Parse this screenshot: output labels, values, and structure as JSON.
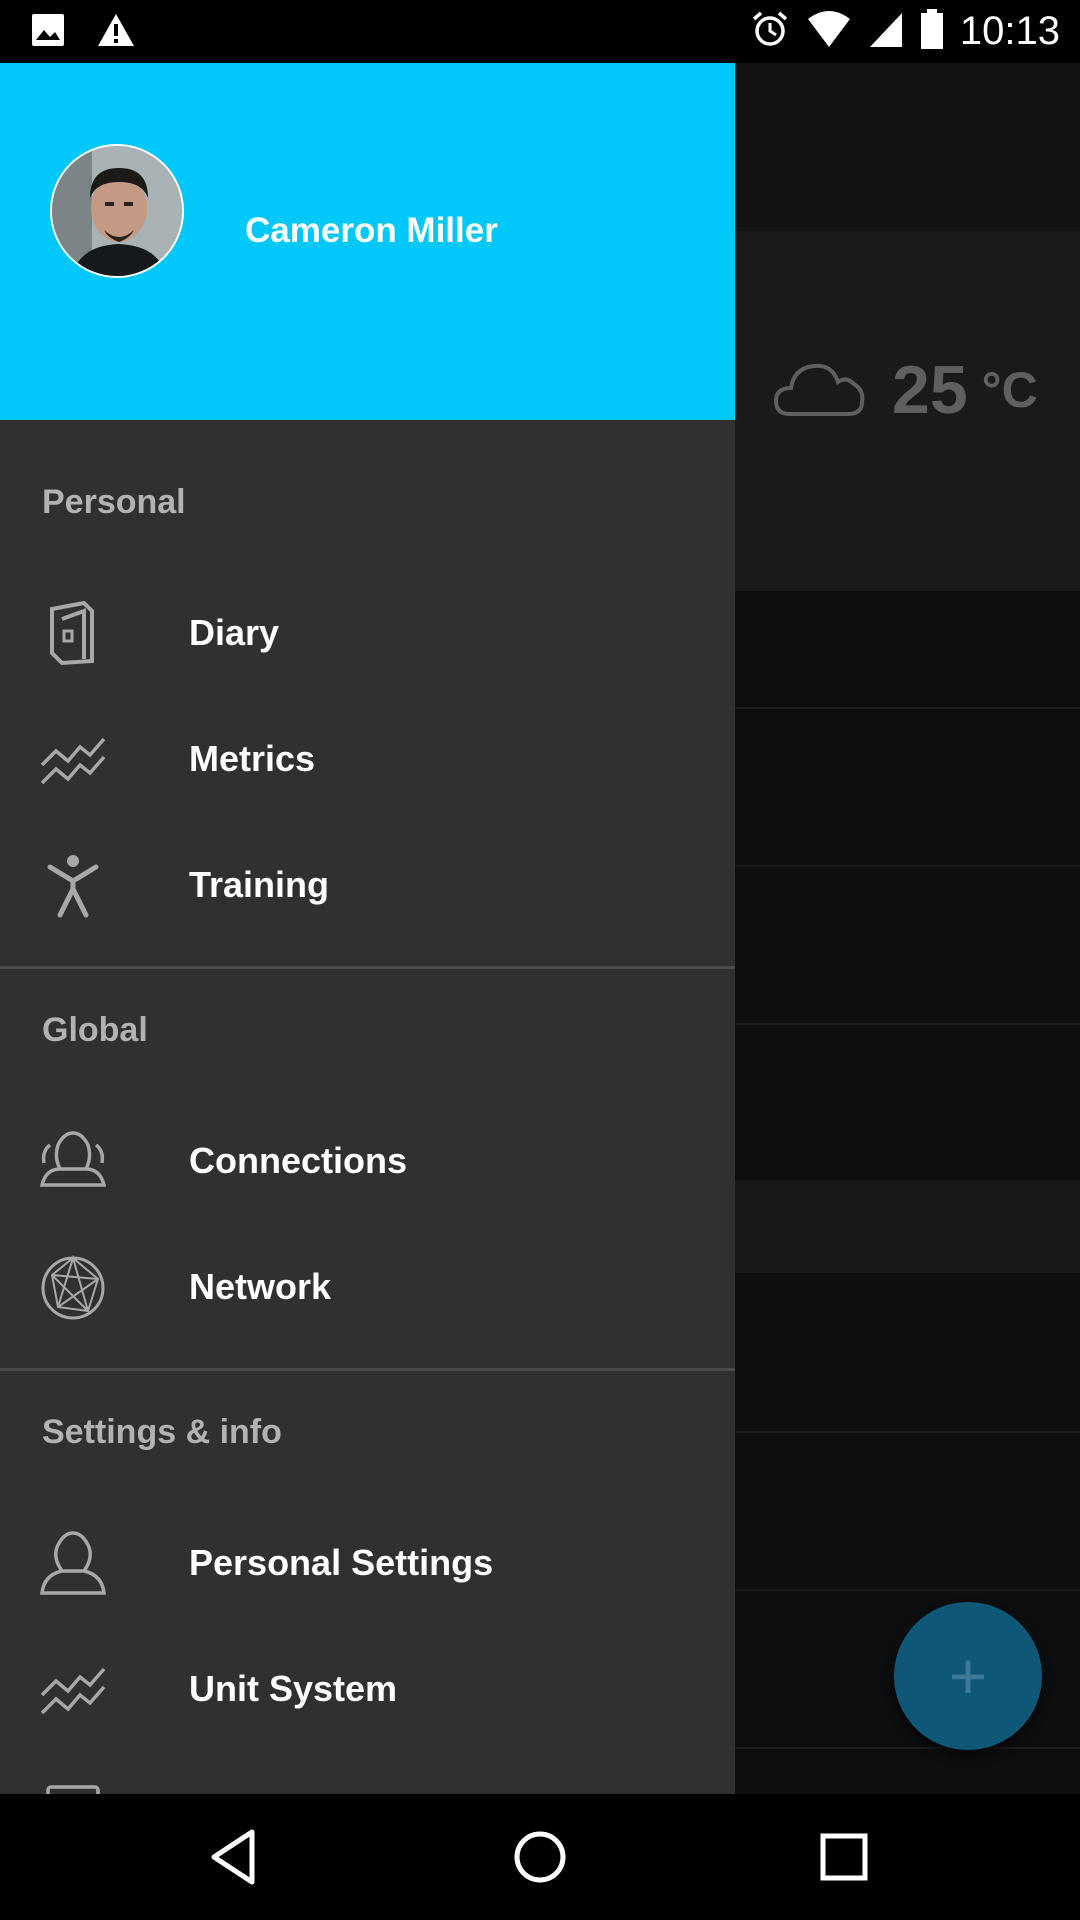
{
  "status_bar": {
    "time": "10:13",
    "left_icons": [
      "image-icon",
      "warning-icon"
    ],
    "right_icons": [
      "alarm-icon",
      "wifi-icon",
      "signal-icon",
      "battery-icon"
    ]
  },
  "background": {
    "weather": {
      "icon": "cloud-icon",
      "temperature": "25",
      "unit": "°C"
    },
    "fab": {
      "icon": "plus-icon",
      "label": "+"
    }
  },
  "drawer": {
    "header": {
      "user_name": "Cameron Miller",
      "avatar": "profile-photo"
    },
    "sections": [
      {
        "title": "Personal",
        "items": [
          {
            "label": "Diary",
            "icon": "diary-icon"
          },
          {
            "label": "Metrics",
            "icon": "metrics-icon"
          },
          {
            "label": "Training",
            "icon": "training-icon"
          }
        ]
      },
      {
        "title": "Global",
        "items": [
          {
            "label": "Connections",
            "icon": "connections-icon"
          },
          {
            "label": "Network",
            "icon": "network-icon"
          }
        ]
      },
      {
        "title": "Settings & info",
        "items": [
          {
            "label": "Personal Settings",
            "icon": "person-icon"
          },
          {
            "label": "Unit System",
            "icon": "unit-system-icon"
          }
        ]
      }
    ]
  },
  "nav_bar": {
    "buttons": [
      "back-icon",
      "home-icon",
      "recents-icon"
    ]
  },
  "colors": {
    "accent": "#00c8fa",
    "drawer_bg": "#303031",
    "fab": "#0e5777"
  }
}
